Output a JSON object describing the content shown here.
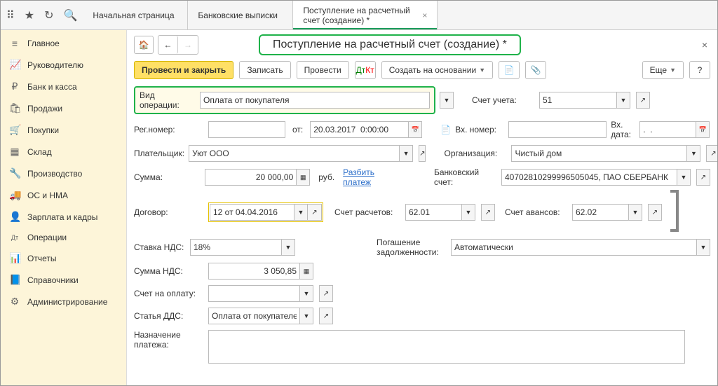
{
  "tabs": {
    "t1": "Начальная страница",
    "t2": "Банковские выписки",
    "t3": "Поступление на расчетный счет (создание) *"
  },
  "sidebar": [
    {
      "icon": "≡",
      "label": "Главное"
    },
    {
      "icon": "📈",
      "label": "Руководителю"
    },
    {
      "icon": "₽",
      "label": "Банк и касса"
    },
    {
      "icon": "🛍",
      "label": "Продажи"
    },
    {
      "icon": "🛒",
      "label": "Покупки"
    },
    {
      "icon": "▦",
      "label": "Склад"
    },
    {
      "icon": "🔧",
      "label": "Производство"
    },
    {
      "icon": "🚚",
      "label": "ОС и НМА"
    },
    {
      "icon": "👤",
      "label": "Зарплата и кадры"
    },
    {
      "icon": "Дт",
      "label": "Операции"
    },
    {
      "icon": "📊",
      "label": "Отчеты"
    },
    {
      "icon": "📘",
      "label": "Справочники"
    },
    {
      "icon": "⚙",
      "label": "Администрирование"
    }
  ],
  "title": "Поступление на расчетный счет (создание) *",
  "toolbar": {
    "post_close": "Провести и закрыть",
    "write": "Записать",
    "post": "Провести",
    "create_based": "Создать на основании",
    "more": "Еще"
  },
  "labels": {
    "op_type": "Вид операции:",
    "account": "Счет учета:",
    "reg_no": "Рег.номер:",
    "from": "от:",
    "ext_no": "Вх. номер:",
    "ext_date": "Вх. дата:",
    "payer": "Плательщик:",
    "org": "Организация:",
    "sum": "Сумма:",
    "rub": "руб.",
    "split": "Разбить платеж",
    "bank_acc": "Банковский счет:",
    "contract": "Договор:",
    "settle_acc": "Счет расчетов:",
    "advance_acc": "Счет авансов:",
    "vat_rate": "Ставка НДС:",
    "debt": "Погашение задолженности:",
    "vat_sum": "Сумма НДС:",
    "pay_acc": "Счет на оплату:",
    "dds": "Статья ДДС:",
    "purpose": "Назначение платежа:"
  },
  "values": {
    "op_type": "Оплата от покупателя",
    "account": "51",
    "reg_no": "",
    "date": "20.03.2017  0:00:00",
    "ext_no": "",
    "ext_date": ".  .",
    "payer": "Уют ООО",
    "org": "Чистый дом",
    "sum": "20 000,00",
    "bank_acc": "40702810299996505045, ПАО СБЕРБАНК",
    "contract": "12 от 04.04.2016",
    "settle_acc": "62.01",
    "advance_acc": "62.02",
    "vat_rate": "18%",
    "debt": "Автоматически",
    "vat_sum": "3 050,85",
    "pay_acc": "",
    "dds": "Оплата от покупателей",
    "purpose": ""
  }
}
